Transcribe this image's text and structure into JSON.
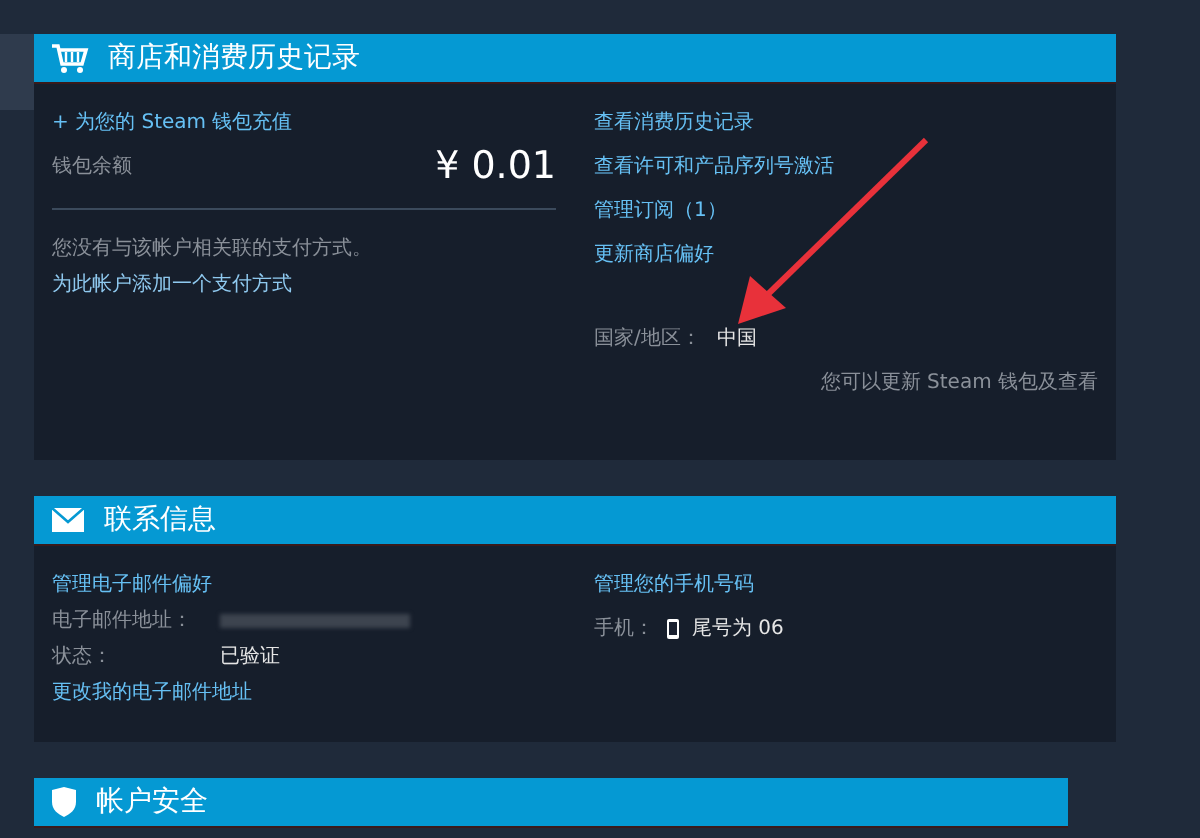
{
  "store": {
    "title": "商店和消费历史记录",
    "add_funds_link": "+ 为您的 Steam 钱包充值",
    "balance_label": "钱包余额",
    "balance": "¥ 0.01",
    "no_payment_text": "您没有与该帐户相关联的支付方式。",
    "add_payment_link": "为此帐户添加一个支付方式",
    "links": [
      "查看消费历史记录",
      "查看许可和产品序列号激活",
      "管理订阅（1）",
      "更新商店偏好"
    ],
    "country_label": "国家/地区：",
    "country": "中国",
    "note": "您可以更新 Steam 钱包及查看"
  },
  "contact": {
    "title": "联系信息",
    "email_prefs_link": "管理电子邮件偏好",
    "email_label": "电子邮件地址：",
    "status_label": "状态：",
    "status": "已验证",
    "change_email_link": "更改我的电子邮件地址",
    "phone_link": "管理您的手机号码",
    "phone_label": "手机：",
    "phone": "尾号为 06"
  },
  "security": {
    "title": "帐户安全"
  }
}
